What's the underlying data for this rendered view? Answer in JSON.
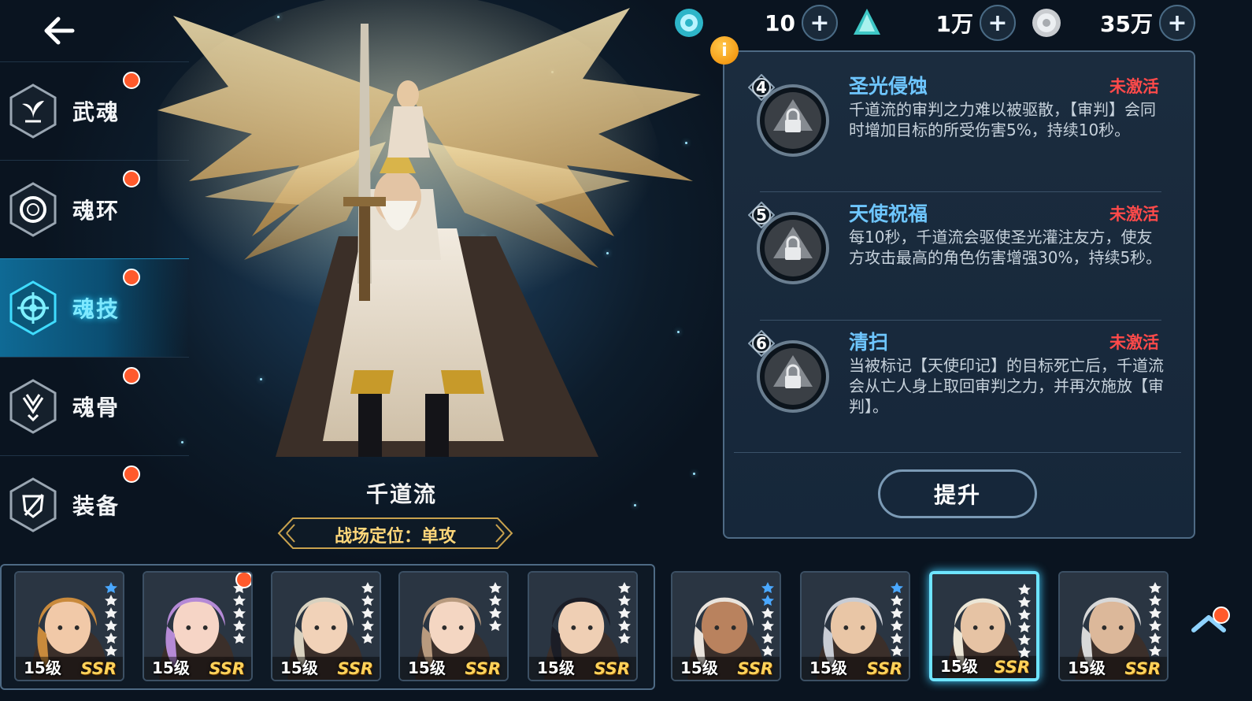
{
  "currency": [
    {
      "icon": "soul-crystal-icon",
      "value": "10"
    },
    {
      "icon": "diamond-icon",
      "value": "1万"
    },
    {
      "icon": "silver-coin-icon",
      "value": "35万"
    }
  ],
  "nav": [
    {
      "key": "wuhun",
      "label": "武魂",
      "icon": "wuhun-icon",
      "active": false
    },
    {
      "key": "huanhuan",
      "label": "魂环",
      "icon": "soul-ring-icon",
      "active": false
    },
    {
      "key": "hunji",
      "label": "魂技",
      "icon": "soul-skill-icon",
      "active": true
    },
    {
      "key": "hungu",
      "label": "魂骨",
      "icon": "soul-bone-icon",
      "active": false
    },
    {
      "key": "zhuangbei",
      "label": "装备",
      "icon": "equipment-icon",
      "active": false
    }
  ],
  "character": {
    "name": "千道流",
    "role": "战场定位：单攻"
  },
  "skills": [
    {
      "num": "4",
      "title": "圣光侵蚀",
      "status": "未激活",
      "desc": "千道流的审判之力难以被驱散，【审判】会同时增加目标的所受伤害5%，持续10秒。"
    },
    {
      "num": "5",
      "title": "天使祝福",
      "status": "未激活",
      "desc": "每10秒，千道流会驱使圣光灌注友方，使友方攻击最高的角色伤害增强30%，持续5秒。"
    },
    {
      "num": "6",
      "title": "清扫",
      "status": "未激活",
      "desc": "当被标记【天使印记】的目标死亡后，千道流会从亡人身上取回审判之力，并再次施放【审判】。"
    }
  ],
  "upgrade_label": "提升",
  "info_label": "i",
  "plus_label": "+",
  "roster": [
    {
      "level": "15级",
      "rarity": "SSR",
      "stars": 6,
      "blue": 1,
      "hair": "#c98a3c",
      "skin": "#f1c9a8",
      "dot": false,
      "selected": false
    },
    {
      "level": "15级",
      "rarity": "SSR",
      "stars": 5,
      "blue": 0,
      "hair": "#b58ad6",
      "skin": "#f6d5c6",
      "dot": true,
      "selected": false
    },
    {
      "level": "15级",
      "rarity": "SSR",
      "stars": 5,
      "blue": 0,
      "hair": "#d9d2c0",
      "skin": "#f1d2b8",
      "dot": false,
      "selected": false
    },
    {
      "level": "15级",
      "rarity": "SSR",
      "stars": 4,
      "blue": 0,
      "hair": "#b89a7e",
      "skin": "#f4d6c2",
      "dot": false,
      "selected": false
    },
    {
      "level": "15级",
      "rarity": "SSR",
      "stars": 5,
      "blue": 0,
      "hair": "#1b1d26",
      "skin": "#efcfb4",
      "dot": false,
      "selected": false
    },
    {
      "level": "15级",
      "rarity": "SSR",
      "stars": 6,
      "blue": 2,
      "hair": "#e9e3dc",
      "skin": "#b9825e",
      "dot": false,
      "selected": false
    },
    {
      "level": "15级",
      "rarity": "SSR",
      "stars": 6,
      "blue": 1,
      "hair": "#c8ccd4",
      "skin": "#e9c6a6",
      "dot": false,
      "selected": false
    },
    {
      "level": "15级",
      "rarity": "SSR",
      "stars": 6,
      "blue": 0,
      "hair": "#ece6d6",
      "skin": "#e6c3a4",
      "dot": false,
      "selected": true
    },
    {
      "level": "15级",
      "rarity": "SSR",
      "stars": 6,
      "blue": 0,
      "hair": "#d8d8d8",
      "skin": "#dcb89a",
      "dot": false,
      "selected": false
    }
  ],
  "colors": {
    "accent": "#6ec6ff",
    "inactive": "#ff4a4a",
    "gold": "#ffd25a",
    "reddot": "#ff5a2c"
  }
}
